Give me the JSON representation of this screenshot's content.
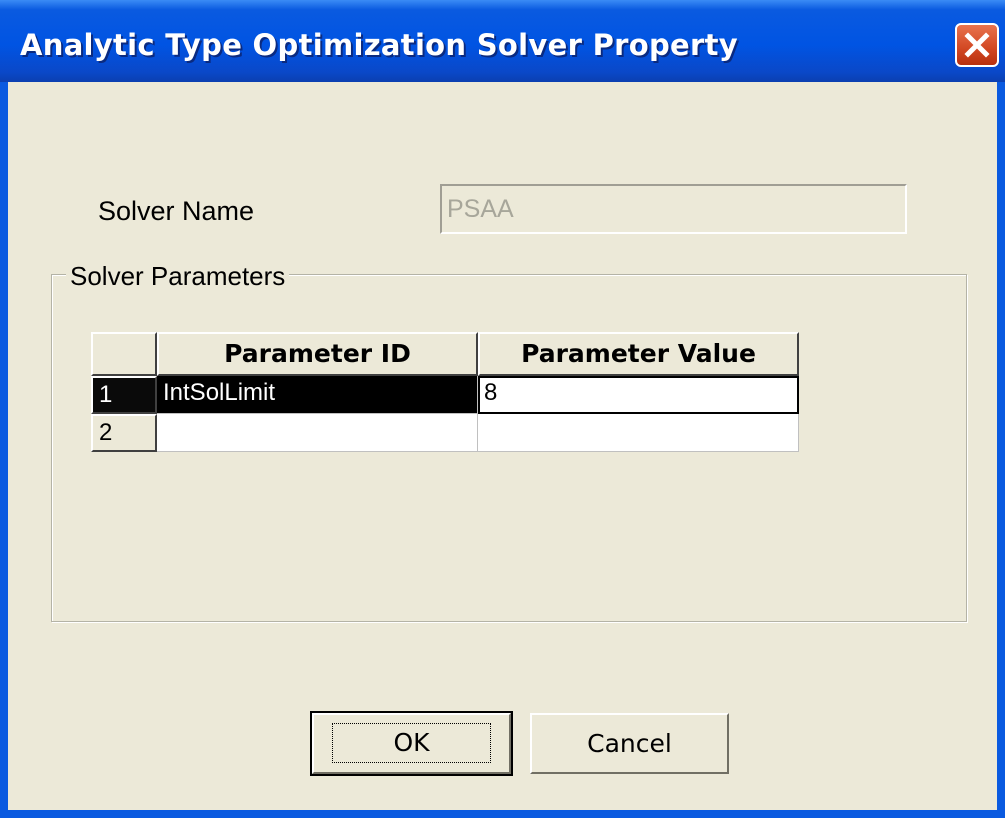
{
  "window": {
    "title": "Analytic Type Optimization Solver Property",
    "title_bar_color": "#0054e3",
    "background_color": "#ece9d8",
    "close_icon": "close-icon"
  },
  "form": {
    "solver_name_label": "Solver Name",
    "solver_name_value": "PSAA",
    "solver_name_disabled": true
  },
  "group": {
    "legend": "Solver Parameters"
  },
  "grid": {
    "columns": [
      "",
      "Parameter ID",
      "Parameter Value"
    ],
    "rows": [
      {
        "row_number": "1",
        "parameter_id": "IntSolLimit",
        "parameter_value": "8",
        "selected": true
      },
      {
        "row_number": "2",
        "parameter_id": "",
        "parameter_value": "",
        "selected": false
      }
    ]
  },
  "buttons": {
    "ok_label": "OK",
    "cancel_label": "Cancel"
  }
}
